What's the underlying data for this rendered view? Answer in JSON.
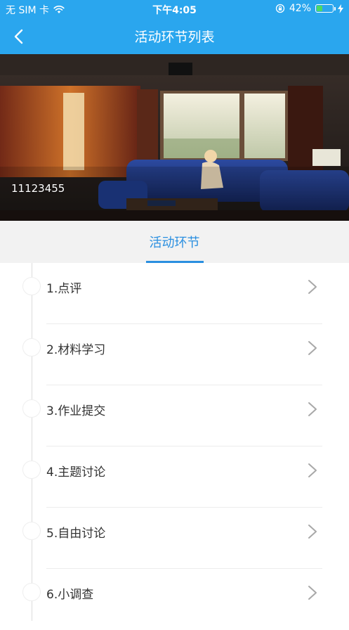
{
  "status_bar": {
    "carrier": "无 SIM 卡",
    "time": "下午4:05",
    "battery_percent": "42%",
    "battery_level": 0.42,
    "icons": [
      "wifi-icon",
      "lock-rotation-icon",
      "battery-icon",
      "charging-icon"
    ]
  },
  "nav": {
    "title": "活动环节列表",
    "back_icon": "chevron-left-icon"
  },
  "banner": {
    "caption": "11123455"
  },
  "tabs": [
    {
      "label": "活动环节",
      "active": true
    }
  ],
  "items": [
    {
      "label": "1.点评"
    },
    {
      "label": "2.材料学习"
    },
    {
      "label": "3.作业提交"
    },
    {
      "label": "4.主题讨论"
    },
    {
      "label": "5.自由讨论"
    },
    {
      "label": "6.小调查"
    }
  ],
  "colors": {
    "header_bg": "#2aa6ee",
    "tab_active": "#2a8fe0",
    "tab_bar_bg": "#f2f2f2",
    "item_text": "#333333",
    "battery_fill": "#4cd964"
  }
}
